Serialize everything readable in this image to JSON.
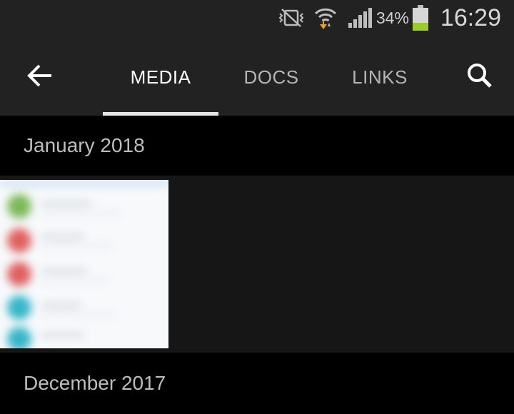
{
  "status_bar": {
    "battery_percent": "34%",
    "time": "16:29",
    "icons": [
      "vibrate-off-icon",
      "wifi-icon",
      "signal-icon",
      "battery-icon"
    ],
    "battery_color": "#9ccc2a"
  },
  "app_bar": {
    "back_icon": "back-arrow-icon",
    "search_icon": "search-icon",
    "tabs": [
      {
        "label": "MEDIA",
        "selected": true
      },
      {
        "label": "DOCS",
        "selected": false
      },
      {
        "label": "LINKS",
        "selected": false
      }
    ]
  },
  "sections": [
    {
      "title": "January 2018",
      "items": [
        "thumbnail"
      ]
    },
    {
      "title": "December 2017"
    }
  ],
  "colors": {
    "bar_background": "#222222",
    "section_header": "#000000",
    "content_background": "#161616",
    "tab_indicator": "#e6e6e6"
  }
}
